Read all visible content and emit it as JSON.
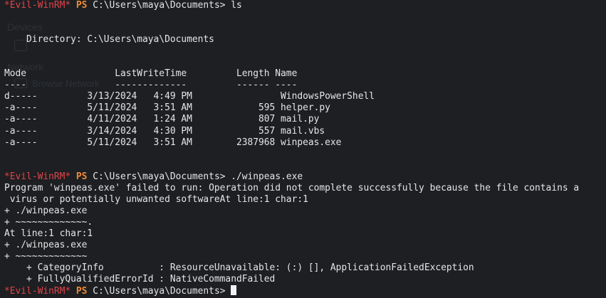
{
  "session": {
    "prompt_tag": "*Evil-WinRM*",
    "ps_label": "PS",
    "cwd": "C:\\Users\\maya\\Documents>"
  },
  "commands": {
    "first": " ls",
    "second": " ./winpeas.exe"
  },
  "listing": {
    "directory_line": "    Directory: C:\\Users\\maya\\Documents",
    "header": "Mode                LastWriteTime         Length Name",
    "underline": "----                -------------         ------ ----",
    "rows": [
      "d-----         3/13/2024   4:49 PM                WindowsPowerShell",
      "-a----         5/11/2024   3:51 AM            595 helper.py",
      "-a----         4/11/2024   1:24 AM            807 mail.py",
      "-a----         3/14/2024   4:30 PM            557 mail.vbs",
      "-a----         5/11/2024   3:51 AM        2387968 winpeas.exe"
    ]
  },
  "error_output": [
    "Program 'winpeas.exe' failed to run: Operation did not complete successfully because the file contains a",
    " virus or potentially unwanted softwareAt line:1 char:1",
    "+ ./winpeas.exe",
    "+ ~~~~~~~~~~~~~.",
    "At line:1 char:1",
    "+ ./winpeas.exe",
    "+ ~~~~~~~~~~~~~",
    "    + CategoryInfo          : ResourceUnavailable: (:) [], ApplicationFailedException",
    "    + FullyQualifiedErrorId : NativeCommandFailed"
  ],
  "background_ghost": {
    "devices": "Devices",
    "network": "Network",
    "browse": "Browse Network"
  },
  "colors": {
    "background": "#1d1f22",
    "prompt_red": "#e0444b",
    "ps_orange": "#f28b35",
    "text": "#e6e6e6"
  }
}
